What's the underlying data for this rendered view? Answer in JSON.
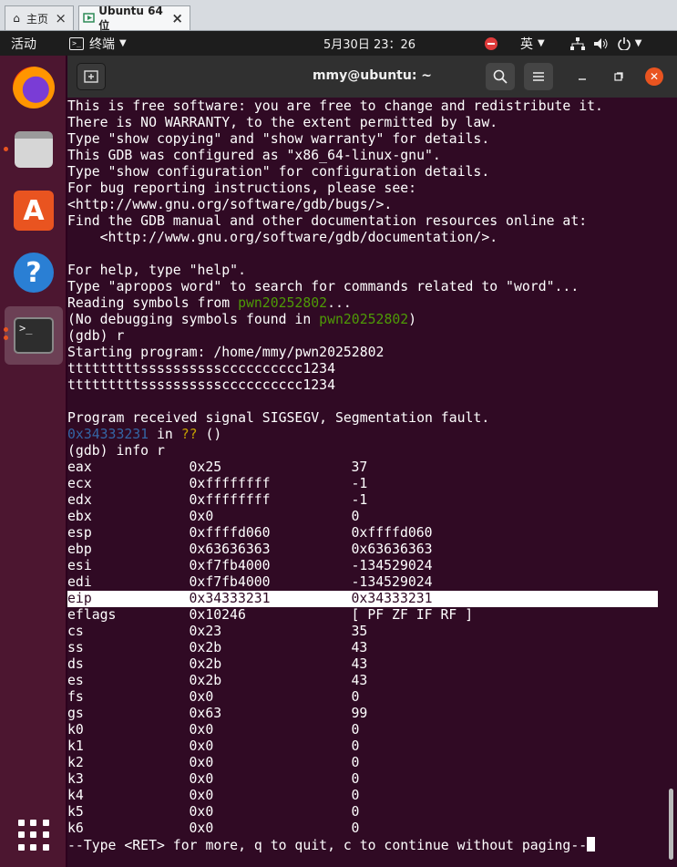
{
  "vmware": {
    "home_tab": "主页",
    "vm_tab": "Ubuntu 64 位",
    "close": "×"
  },
  "topbar": {
    "activities": "活动",
    "app_name": "终端",
    "clock": "5月30日  23：26",
    "input_method": "英"
  },
  "dock": {
    "items": [
      "firefox-icon",
      "files-icon",
      "ubuntu-software-icon",
      "help-icon",
      "terminal-icon"
    ]
  },
  "terminal_window": {
    "title": "mmy@ubuntu: ~",
    "accent": "#e95420",
    "background": "#300a24"
  },
  "terminal": {
    "intro": [
      "This is free software: you are free to change and redistribute it.",
      "There is NO WARRANTY, to the extent permitted by law.",
      "Type \"show copying\" and \"show warranty\" for details.",
      "This GDB was configured as \"x86_64-linux-gnu\".",
      "Type \"show configuration\" for configuration details.",
      "For bug reporting instructions, please see:",
      "<http://www.gnu.org/software/gdb/bugs/>.",
      "Find the GDB manual and other documentation resources online at:",
      "    <http://www.gnu.org/software/gdb/documentation/>.",
      "",
      "For help, type \"help\".",
      "Type \"apropos word\" to search for commands related to \"word\"..."
    ],
    "reading_prefix": "Reading symbols from ",
    "binary": "pwn20252802",
    "reading_suffix": "...",
    "nodebug_prefix": "(No debugging symbols found in ",
    "nodebug_suffix": ")",
    "cmd_run": "(gdb) r",
    "starting": "Starting program: /home/mmy/pwn20252802",
    "input_echo": "tttttttttsssssssssscccccccccc1234",
    "output_echo": "tttttttttsssssssssscccccccccc1234",
    "signal": "Program received signal SIGSEGV, Segmentation fault.",
    "crash_addr": "0x34333231",
    "crash_in": " in ",
    "crash_func": "??",
    "crash_paren": " ()",
    "cmd_info": "(gdb) info r",
    "registers": [
      {
        "name": "eax",
        "hex": "0x25",
        "val": "37"
      },
      {
        "name": "ecx",
        "hex": "0xffffffff",
        "val": "-1"
      },
      {
        "name": "edx",
        "hex": "0xffffffff",
        "val": "-1"
      },
      {
        "name": "ebx",
        "hex": "0x0",
        "val": "0"
      },
      {
        "name": "esp",
        "hex": "0xffffd060",
        "val": "0xffffd060"
      },
      {
        "name": "ebp",
        "hex": "0x63636363",
        "val": "0x63636363"
      },
      {
        "name": "esi",
        "hex": "0xf7fb4000",
        "val": "-134529024"
      },
      {
        "name": "edi",
        "hex": "0xf7fb4000",
        "val": "-134529024"
      },
      {
        "name": "eip",
        "hex": "0x34333231",
        "val": "0x34333231"
      },
      {
        "name": "eflags",
        "hex": "0x10246",
        "val": "[ PF ZF IF RF ]"
      },
      {
        "name": "cs",
        "hex": "0x23",
        "val": "35"
      },
      {
        "name": "ss",
        "hex": "0x2b",
        "val": "43"
      },
      {
        "name": "ds",
        "hex": "0x2b",
        "val": "43"
      },
      {
        "name": "es",
        "hex": "0x2b",
        "val": "43"
      },
      {
        "name": "fs",
        "hex": "0x0",
        "val": "0"
      },
      {
        "name": "gs",
        "hex": "0x63",
        "val": "99"
      },
      {
        "name": "k0",
        "hex": "0x0",
        "val": "0"
      },
      {
        "name": "k1",
        "hex": "0x0",
        "val": "0"
      },
      {
        "name": "k2",
        "hex": "0x0",
        "val": "0"
      },
      {
        "name": "k3",
        "hex": "0x0",
        "val": "0"
      },
      {
        "name": "k4",
        "hex": "0x0",
        "val": "0"
      },
      {
        "name": "k5",
        "hex": "0x0",
        "val": "0"
      },
      {
        "name": "k6",
        "hex": "0x0",
        "val": "0"
      }
    ],
    "highlighted_register": "eip",
    "pager": "--Type <RET> for more, q to quit, c to continue without paging--"
  }
}
